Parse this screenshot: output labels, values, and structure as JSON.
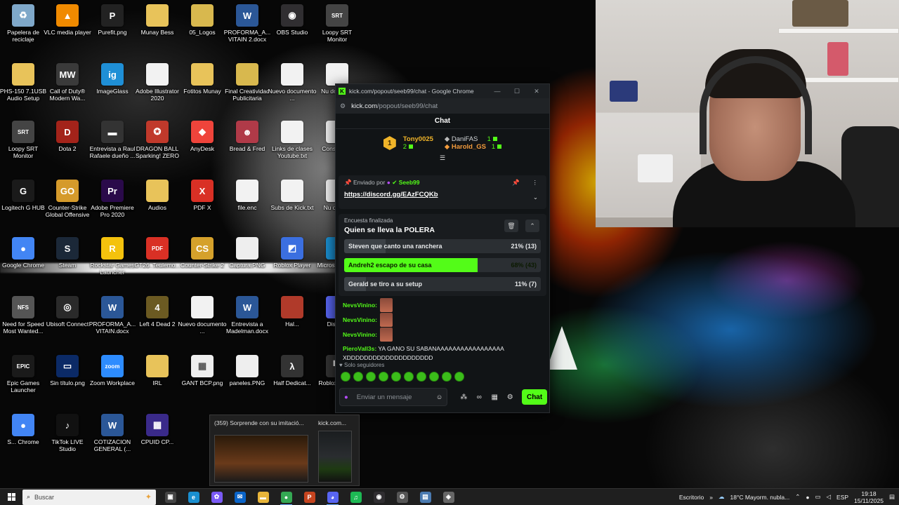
{
  "desktop": {
    "icons": [
      {
        "label": "Papelera de reciclaje",
        "icon": "recycle-bin-icon",
        "color": "#7fa8c9",
        "glyph": "♻"
      },
      {
        "label": "VLC media player",
        "icon": "vlc-icon",
        "color": "#f08a00",
        "glyph": "▲"
      },
      {
        "label": "Purefit.png",
        "icon": "image-file-icon",
        "color": "#222222",
        "glyph": "P"
      },
      {
        "label": "Munay Bess",
        "icon": "folder-icon",
        "color": "#e8c35a",
        "glyph": ""
      },
      {
        "label": "05_Logos",
        "icon": "folder-icon",
        "color": "#d8b84e",
        "glyph": ""
      },
      {
        "label": "PROFORMA_A... VITAIN 2.docx",
        "icon": "word-icon",
        "color": "#2b5797",
        "glyph": "W"
      },
      {
        "label": "OBS Studio",
        "icon": "obs-icon",
        "color": "#302e31",
        "glyph": "◉"
      },
      {
        "label": "Loopy SRT Monitor",
        "icon": "srt-icon",
        "color": "#444444",
        "glyph": "SRT"
      },
      {
        "label": "PHS-150 7.1USB Audio Setup",
        "icon": "folder-icon",
        "color": "#e8c35a",
        "glyph": ""
      },
      {
        "label": "Call of Duty® Modern Wa...",
        "icon": "cod-icon",
        "color": "#3a3a3a",
        "glyph": "MW"
      },
      {
        "label": "ImageGlass",
        "icon": "imageglass-icon",
        "color": "#1f8fd6",
        "glyph": "ig"
      },
      {
        "label": "Adobe Illustrator 2020",
        "icon": "file-icon",
        "color": "#f2f2f2",
        "glyph": ""
      },
      {
        "label": "Fotitos Munay",
        "icon": "folder-icon",
        "color": "#e8c35a",
        "glyph": ""
      },
      {
        "label": "Final Creatividad Publicitaria",
        "icon": "folder-icon",
        "color": "#d8b84e",
        "glyph": ""
      },
      {
        "label": "Nuevo documento ...",
        "icon": "file-icon",
        "color": "#f2f2f2",
        "glyph": ""
      },
      {
        "label": "Nu docum...",
        "icon": "file-icon",
        "color": "#f2f2f2",
        "glyph": ""
      },
      {
        "label": "Loopy SRT Monitor",
        "icon": "srt-icon",
        "color": "#444444",
        "glyph": "SRT"
      },
      {
        "label": "Dota 2",
        "icon": "dota-icon",
        "color": "#a3231a",
        "glyph": "D"
      },
      {
        "label": "Entrevista a Raul Rafaele dueño ...",
        "icon": "file-icon",
        "color": "#333333",
        "glyph": "▬"
      },
      {
        "label": "DRAGON BALL Sparking! ZERO",
        "icon": "dragonball-icon",
        "color": "#c0392b",
        "glyph": "✪"
      },
      {
        "label": "AnyDesk",
        "icon": "anydesk-icon",
        "color": "#ef443b",
        "glyph": "◆"
      },
      {
        "label": "Bread & Fred",
        "icon": "game-icon",
        "color": "#b03a48",
        "glyph": "☻"
      },
      {
        "label": "Links de clases Youtube.txt",
        "icon": "text-file-icon",
        "color": "#f2f2f2",
        "glyph": ""
      },
      {
        "label": "Consu de...",
        "icon": "file-icon",
        "color": "#f2f2f2",
        "glyph": ""
      },
      {
        "label": "Logitech G HUB",
        "icon": "logitech-icon",
        "color": "#1a1a1a",
        "glyph": "G"
      },
      {
        "label": "Counter-Strike Global Offensive",
        "icon": "csgo-icon",
        "color": "#d59a2b",
        "glyph": "GO"
      },
      {
        "label": "Adobe Premiere Pro 2020",
        "icon": "premiere-icon",
        "color": "#2a0a4a",
        "glyph": "Pr"
      },
      {
        "label": "Audios",
        "icon": "folder-icon",
        "color": "#e8c35a",
        "glyph": ""
      },
      {
        "label": "PDF X",
        "icon": "pdf-icon",
        "color": "#d93025",
        "glyph": "X"
      },
      {
        "label": "file.enc",
        "icon": "file-icon",
        "color": "#f2f2f2",
        "glyph": ""
      },
      {
        "label": "Subs de Kick.txt",
        "icon": "text-file-icon",
        "color": "#f2f2f2",
        "glyph": ""
      },
      {
        "label": "Nu docu...",
        "icon": "file-icon",
        "color": "#f2f2f2",
        "glyph": ""
      },
      {
        "label": "Google Chrome",
        "icon": "chrome-icon",
        "color": "#4285f4",
        "glyph": "●"
      },
      {
        "label": "Steam",
        "icon": "steam-icon",
        "color": "#1b2838",
        "glyph": "S"
      },
      {
        "label": "Rockstar Games Launcher",
        "icon": "rockstar-icon",
        "color": "#f4c20d",
        "glyph": "R"
      },
      {
        "label": "GT26_Teulemo...",
        "icon": "pdf-icon",
        "color": "#d93025",
        "glyph": "PDF"
      },
      {
        "label": "Counter-Strike 2",
        "icon": "cs2-icon",
        "color": "#d5a12b",
        "glyph": "CS"
      },
      {
        "label": "Captura.PNG",
        "icon": "image-file-icon",
        "color": "#eeeeee",
        "glyph": ""
      },
      {
        "label": "Roblox Player",
        "icon": "roblox-icon",
        "color": "#3b6fe0",
        "glyph": "◩"
      },
      {
        "label": "Microsoft Edge",
        "icon": "edge-icon",
        "color": "#1a8fd0",
        "glyph": "e"
      },
      {
        "label": "Need for Speed Most Wanted...",
        "icon": "nfs-icon",
        "color": "#555555",
        "glyph": "NFS"
      },
      {
        "label": "Ubisoft Connect",
        "icon": "ubisoft-icon",
        "color": "#2a2a2a",
        "glyph": "◎"
      },
      {
        "label": "PROFORMA_A... VITAIN.docx",
        "icon": "word-icon",
        "color": "#2b5797",
        "glyph": "W"
      },
      {
        "label": "Left 4 Dead 2",
        "icon": "l4d2-icon",
        "color": "#6b5a22",
        "glyph": "4"
      },
      {
        "label": "Nuevo documento ...",
        "icon": "file-icon",
        "color": "#f2f2f2",
        "glyph": ""
      },
      {
        "label": "Entrevista a Madelman.docx",
        "icon": "word-icon",
        "color": "#2b5797",
        "glyph": "W"
      },
      {
        "label": "Hal...",
        "icon": "game-icon",
        "color": "#b03a2a",
        "glyph": ""
      },
      {
        "label": "Discord",
        "icon": "discord-icon",
        "color": "#5865f2",
        "glyph": "◕"
      },
      {
        "label": "Epic Games Launcher",
        "icon": "epic-icon",
        "color": "#1a1a1a",
        "glyph": "EPIC"
      },
      {
        "label": "Sin título.png",
        "icon": "image-file-icon",
        "color": "#0b2a66",
        "glyph": "▭"
      },
      {
        "label": "Zoom Workplace",
        "icon": "zoom-icon",
        "color": "#2d8cff",
        "glyph": "zoom"
      },
      {
        "label": "IRL",
        "icon": "folder-icon",
        "color": "#e8c35a",
        "glyph": ""
      },
      {
        "label": "GANT BCP.png",
        "icon": "image-file-icon",
        "color": "#eeeeee",
        "glyph": "▦"
      },
      {
        "label": "paneles.PNG",
        "icon": "image-file-icon",
        "color": "#eeeeee",
        "glyph": ""
      },
      {
        "label": "Half Dedicat...",
        "icon": "game-icon",
        "color": "#333333",
        "glyph": "λ"
      },
      {
        "label": "Roblox Studio",
        "icon": "roblox-studio-icon",
        "color": "#333333",
        "glyph": "▚"
      },
      {
        "label": "S... Chrome",
        "icon": "chrome-icon",
        "color": "#4285f4",
        "glyph": "●"
      },
      {
        "label": "TikTok LIVE Studio",
        "icon": "tiktok-icon",
        "color": "#111111",
        "glyph": "♪"
      },
      {
        "label": "COTIZACION GENERAL (...",
        "icon": "word-icon",
        "color": "#2b5797",
        "glyph": "W"
      },
      {
        "label": "CPUID CP...",
        "icon": "cpuid-icon",
        "color": "#3a2a8a",
        "glyph": "▦"
      }
    ]
  },
  "chrome_window": {
    "title": "kick.com/popout/seeb99/chat - Google Chrome",
    "url_host": "kick.com",
    "url_path": "/popout/seeb99/chat",
    "chat_title": "Chat",
    "leaderboard": {
      "first": {
        "rank": "1",
        "name": "Tony0025",
        "count": "2"
      },
      "second": {
        "name": "DaniFAS",
        "count": "1"
      },
      "third": {
        "name": "Harold_GS",
        "count": "1"
      }
    },
    "pinned": {
      "by_label": "Enviado por",
      "by_user": "Seeb99",
      "link": "https://discord.gg/EAzFCQKb"
    },
    "poll": {
      "status": "Encuesta finalizada",
      "question": "Quien se lleva la POLERA",
      "options": [
        {
          "text": "Steven que canto una ranchera",
          "pct_label": "21% (13)",
          "fraction": 0.21,
          "winner": false
        },
        {
          "text": "Andreh2 escapo de su casa",
          "pct_label": "68% (43)",
          "fraction": 0.68,
          "winner": true
        },
        {
          "text": "Gerald se tiro a su setup",
          "pct_label": "11% (7)",
          "fraction": 0.11,
          "winner": false
        }
      ]
    },
    "messages": [
      {
        "user": "NevsVinino:",
        "emote": true
      },
      {
        "user": "NevsVinino:",
        "emote": true
      },
      {
        "user": "NevsVinino:",
        "emote": true
      }
    ],
    "last_message": {
      "user": "PieroVall3s:",
      "text": "YA GANO SU SABANAAAAAAAAAAAAAAAAA XDDDDDDDDDDDDDDDDDDDD"
    },
    "followers_only": "Solo seguidores",
    "input_placeholder": "Enviar un mensaje",
    "send_label": "Chat"
  },
  "thumbnail_popup": {
    "first_title": "(359) Sorprende con su imitació...",
    "second_title": "kick.com..."
  },
  "taskbar": {
    "search_placeholder": "Buscar",
    "apps": [
      {
        "name": "task-view",
        "glyph": "▣",
        "color": "#444444"
      },
      {
        "name": "edge",
        "glyph": "e",
        "color": "#1a8fd0"
      },
      {
        "name": "copilot",
        "glyph": "✿",
        "color": "#7a5af5"
      },
      {
        "name": "outlook",
        "glyph": "✉",
        "color": "#0a64c8"
      },
      {
        "name": "file-explorer",
        "glyph": "▬",
        "color": "#e8b53a"
      },
      {
        "name": "chrome",
        "glyph": "●",
        "color": "#34a853"
      },
      {
        "name": "powerpoint",
        "glyph": "P",
        "color": "#c5441f"
      },
      {
        "name": "discord",
        "glyph": "◕",
        "color": "#5865f2"
      },
      {
        "name": "spotify",
        "glyph": "♫",
        "color": "#1db954"
      },
      {
        "name": "obs",
        "glyph": "◉",
        "color": "#302e31"
      },
      {
        "name": "settings",
        "glyph": "⚙",
        "color": "#555555"
      },
      {
        "name": "app-generic",
        "glyph": "▤",
        "color": "#4a7ab0"
      },
      {
        "name": "app-generic-2",
        "glyph": "◈",
        "color": "#666666"
      }
    ],
    "desktop_label": "Escritorio",
    "weather": "18°C  Mayorm. nubla...",
    "language": "ESP",
    "time": "19:18",
    "date": "15/11/2025"
  }
}
